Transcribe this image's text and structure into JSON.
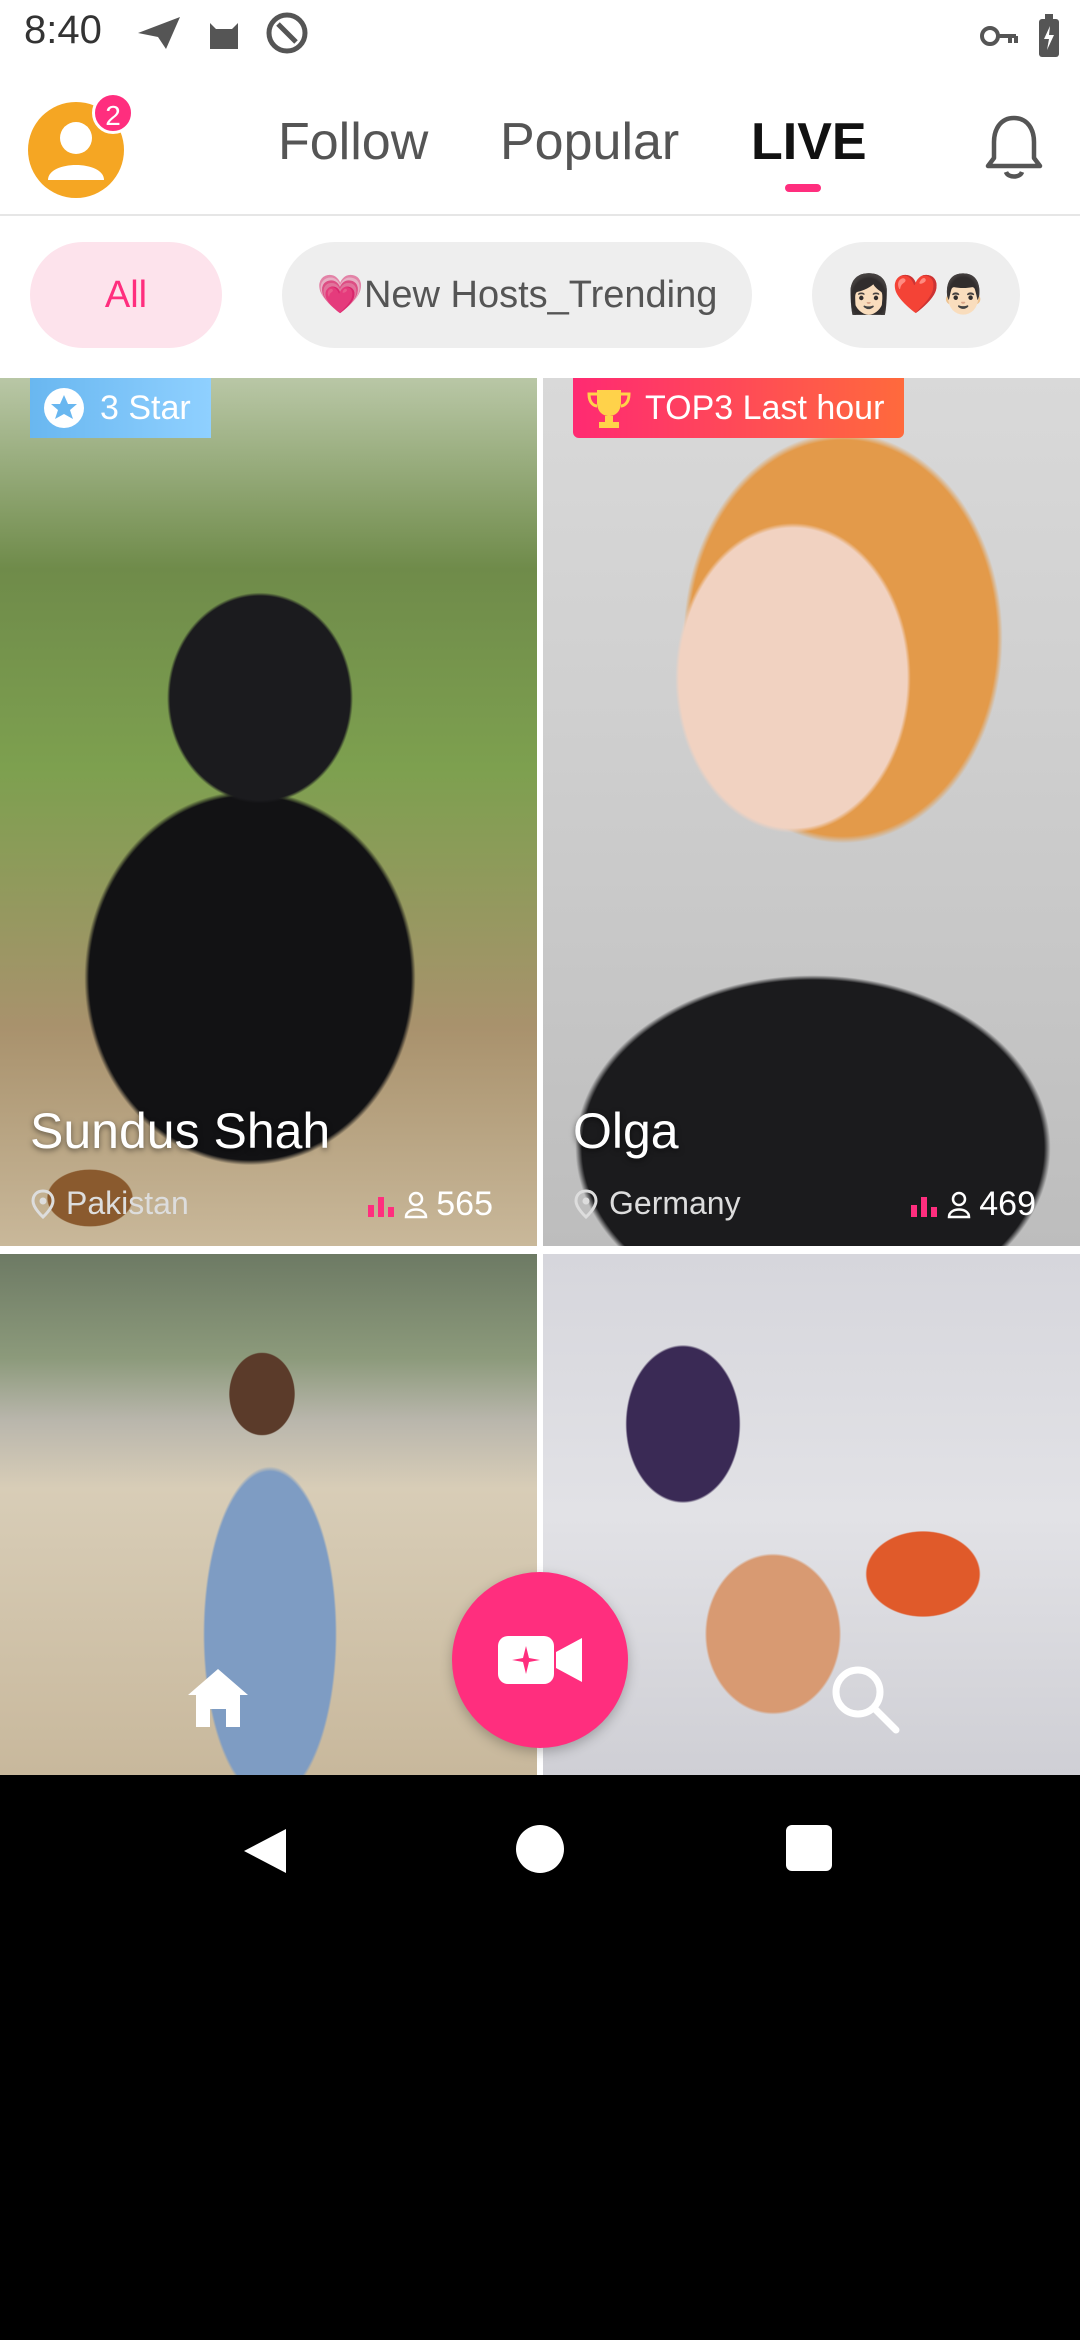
{
  "status_bar": {
    "time": "8:40",
    "left_icons": [
      "send-icon",
      "cat-icon",
      "at-sign-icon"
    ],
    "right_icons": [
      "key-icon",
      "battery-charging-icon"
    ]
  },
  "header": {
    "avatar_badge": "2",
    "tabs": [
      {
        "label": "Follow",
        "active": false
      },
      {
        "label": "Popular",
        "active": false
      },
      {
        "label": "LIVE",
        "active": true
      }
    ],
    "accent_color": "#ff2e7e"
  },
  "chips": [
    {
      "label": "All",
      "active": true
    },
    {
      "label": "💗New Hosts_Trending",
      "active": false
    },
    {
      "label": "👩🏻❤️👨🏻",
      "active": false
    }
  ],
  "cards": [
    {
      "tag": "3 Star",
      "tag_type": "star",
      "name": "Sundus Shah",
      "location": "Pakistan",
      "viewers": "565"
    },
    {
      "tag": "TOP3 Last hour",
      "tag_type": "top3",
      "name": "Olga",
      "location": "Germany",
      "viewers": "469"
    },
    {
      "tag": "",
      "name": "",
      "location": "",
      "viewers": ""
    },
    {
      "tag": "",
      "name": "",
      "location": "",
      "viewers": ""
    }
  ],
  "bottom_nav": {
    "items": [
      "home-icon",
      "go-live-video-icon",
      "search-icon"
    ]
  }
}
